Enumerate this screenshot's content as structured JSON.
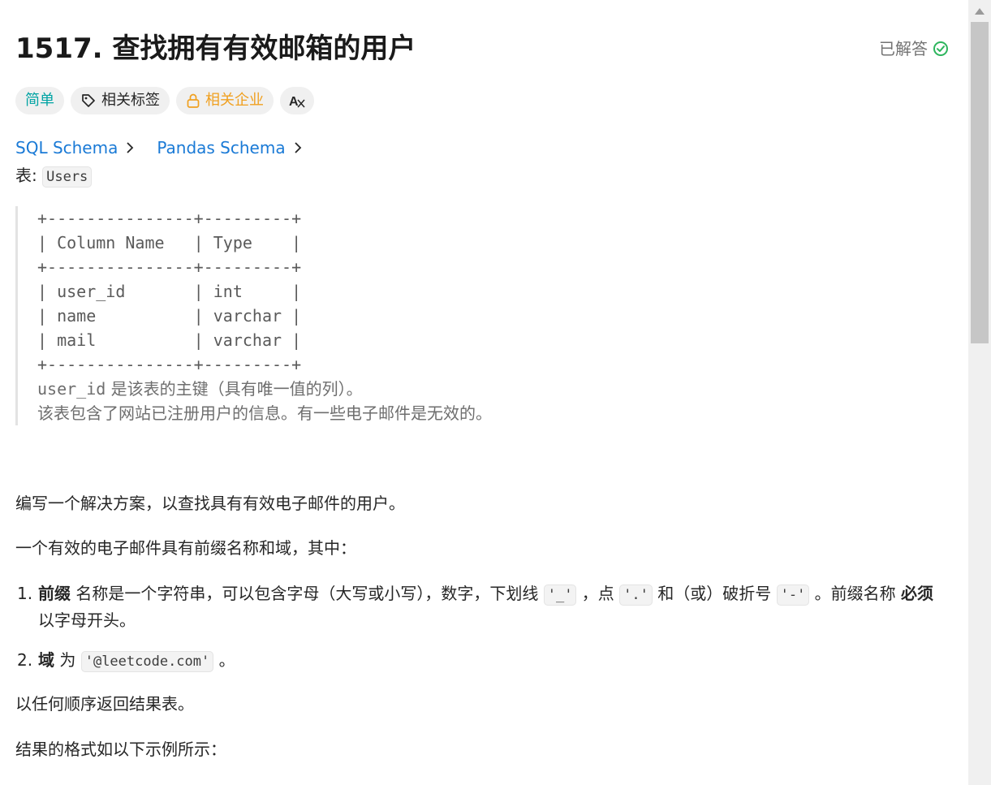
{
  "header": {
    "title": "1517. 查找拥有有效邮箱的用户",
    "status_label": "已解答"
  },
  "tags": {
    "difficulty": "简单",
    "related_tags": "相关标签",
    "related_companies": "相关企业",
    "translate_icon_text": "A"
  },
  "schemas": {
    "sql": "SQL Schema",
    "pandas": "Pandas Schema"
  },
  "table_intro": {
    "label": "表: ",
    "table_name": "Users"
  },
  "schema_block": {
    "ascii_table": "+---------------+---------+\n| Column Name   | Type    |\n+---------------+---------+\n| user_id       | int     |\n| name          | varchar |\n| mail          | varchar |\n+---------------+---------+",
    "note_key": "user_id",
    "note_key_desc": " 是该表的主键（具有唯一值的列）。",
    "note_line2": "该表包含了网站已注册用户的信息。有一些电子邮件是无效的。"
  },
  "description": {
    "p1": "编写一个解决方案，以查找具有有效电子邮件的用户。",
    "p2": "一个有效的电子邮件具有前缀名称和域，其中：",
    "item1": {
      "num": "1.",
      "bold1": "前缀",
      "text1": " 名称是一个字符串，可以包含字母（大写或小写），数字，下划线 ",
      "code1": "'_'",
      "text2": " ，点 ",
      "code2": "'.'",
      "text3": " 和（或）破折号 ",
      "code3": "'-'",
      "text4": " 。前缀名称 ",
      "bold2": "必须",
      "text5": " 以字母开头。"
    },
    "item2": {
      "num": "2.",
      "bold": "域",
      "text1": " 为 ",
      "code": "'@leetcode.com'",
      "text2": " 。"
    },
    "p3": "以任何顺序返回结果表。",
    "p4": "结果的格式如以下示例所示："
  },
  "colors": {
    "easy": "#00a3a3",
    "company": "#f0a020",
    "link": "#1a7ad6",
    "solved_check": "#2db55d"
  },
  "icons": [
    "check-circle-icon",
    "tag-icon",
    "lock-icon",
    "translate-icon",
    "chevron-right-icon"
  ]
}
